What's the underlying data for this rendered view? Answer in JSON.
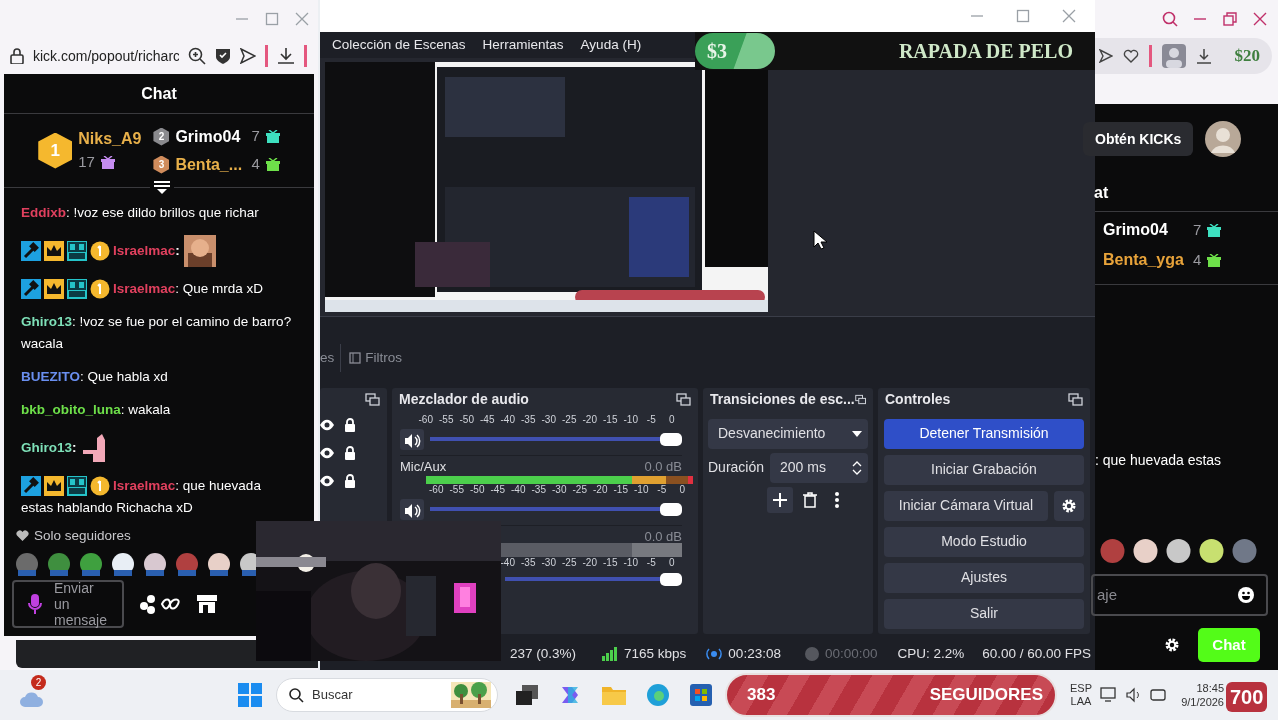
{
  "chat_window": {
    "url": "kick.com/popout/richarc",
    "title": "Chat",
    "leaders": [
      {
        "rank": "1",
        "name": "Niks_A9",
        "count": "17",
        "color": "#e8b04a"
      },
      {
        "rank": "2",
        "name": "Grimo04",
        "count": "7",
        "color": "#ffffff"
      },
      {
        "rank": "3",
        "name": "Benta_...",
        "count": "4",
        "color": "#e8b04a"
      }
    ],
    "messages": [
      {
        "kind": "text",
        "badges": false,
        "user": "Eddixb",
        "color": "#e0405e",
        "text": ": !voz ese dildo brillos que richar"
      },
      {
        "kind": "emote",
        "badges": true,
        "user": "Israelmac",
        "color": "#e0405e",
        "text": ":"
      },
      {
        "kind": "text",
        "badges": true,
        "user": "Israelmac",
        "color": "#e0405e",
        "text": ": Que mrda xD"
      },
      {
        "kind": "text",
        "badges": false,
        "user": "Ghiro13",
        "color": "#7ee0b8",
        "text": ": !voz se fue por el camino de barro? wacala"
      },
      {
        "kind": "text",
        "badges": false,
        "user": "BUEZITO",
        "color": "#6a8ff0",
        "text": ": Que habla xd"
      },
      {
        "kind": "text",
        "badges": false,
        "user": "bkb_obito_luna",
        "color": "#6ee04a",
        "text": ": wakala"
      },
      {
        "kind": "emote",
        "badges": false,
        "user": "Ghiro13",
        "color": "#7ee0b8",
        "text": ":"
      },
      {
        "kind": "text",
        "badges": true,
        "user": "Israelmac",
        "color": "#e0405e",
        "text": ": que huevada",
        "continuation": "estas hablando Richacha xD"
      }
    ],
    "followers_only": "Solo seguidores",
    "placeholder": "Enviar un mensaje"
  },
  "obs": {
    "menus": [
      "Colección de Escenas",
      "Herramientas",
      "Ayuda (H)"
    ],
    "overlay": {
      "amount": "$3",
      "title": "RAPADA DE PELO"
    },
    "tabs": [
      "es",
      "Filtros"
    ],
    "sources": [
      {
        "visible": true,
        "locked": true
      },
      {
        "visible": true,
        "locked": true
      },
      {
        "visible": true,
        "locked": true
      }
    ],
    "mixer": {
      "title": "Mezclador de audio",
      "channels": [
        {
          "kind": "hidden",
          "level": 1,
          "scale": [
            "-60",
            "-55",
            "-50",
            "-45",
            "-40",
            "-35",
            "-30",
            "-25",
            "-20",
            "-15",
            "-10",
            "-5",
            "0"
          ]
        },
        {
          "kind": "active",
          "name": "Mic/Aux",
          "reading": "0.0 dB",
          "level": 1,
          "scale": [
            "-60",
            "-55",
            "-50",
            "-45",
            "-40",
            "-35",
            "-30",
            "-25",
            "-20",
            "-15",
            "-10",
            "-5",
            "0"
          ]
        },
        {
          "kind": "idle",
          "reading": "0.0 dB",
          "level": 1,
          "scale": [
            "-40",
            "-35",
            "-30",
            "-25",
            "-20",
            "-15",
            "-10",
            "-5",
            "0"
          ]
        }
      ]
    },
    "transitions": {
      "title": "Transiciones de esc...",
      "transition": "Desvanecimiento",
      "duration_label": "Duración",
      "duration": "200 ms"
    },
    "controls": {
      "title": "Controles",
      "buttons": [
        {
          "label": "Detener Transmisión",
          "active": true,
          "gear": false
        },
        {
          "label": "Iniciar Grabación",
          "active": false,
          "gear": false
        },
        {
          "label": "Iniciar Cámara Virtual",
          "active": false,
          "gear": true
        },
        {
          "label": "Modo Estudio",
          "active": false,
          "gear": false
        },
        {
          "label": "Ajustes",
          "active": false,
          "gear": false
        },
        {
          "label": "Salir",
          "active": false,
          "gear": false
        }
      ]
    },
    "status": {
      "dropped": "237 (0.3%)",
      "bitrate": "7165 kbps",
      "live_time": "00:23:08",
      "rec_time": "00:00:00",
      "cpu": "CPU: 2.2%",
      "fps": "60.00 / 60.00 FPS"
    }
  },
  "right_window": {
    "overlay_amount": "$20",
    "get_kicks": "Obtén KICKs",
    "chat_title": "at",
    "leaders": [
      {
        "name": "Grimo04",
        "count": "7",
        "color": "#ffffff"
      },
      {
        "name": "Benta_yga",
        "count": "4",
        "color": "#e8a33a"
      }
    ],
    "message": ": que huevada estas",
    "placeholder": "aje",
    "send": "Chat"
  },
  "taskbar": {
    "notifications": "2",
    "search": "Buscar",
    "lang": [
      "ESP",
      "LAA"
    ],
    "time": "18:45",
    "date": "9/1/2026"
  },
  "followers_overlay": {
    "count": "383",
    "label": "SEGUIDORES",
    "goal": "700"
  }
}
